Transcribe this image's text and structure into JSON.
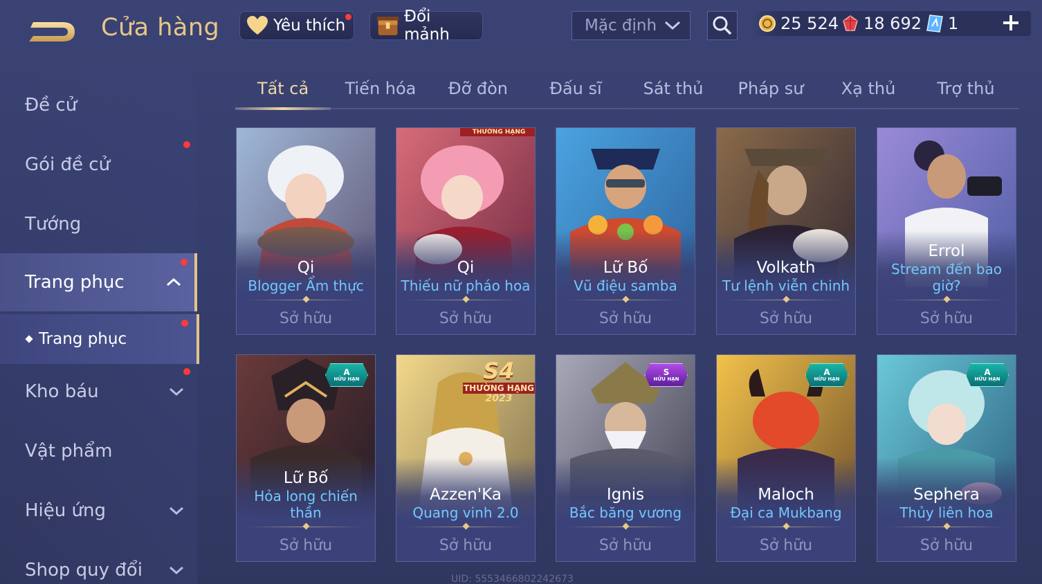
{
  "header": {
    "title": "Cửa hàng",
    "favorite_label": "Yêu thích",
    "fragment_label": "Đổi mảnh",
    "sort": {
      "selected": "Mặc định"
    },
    "currencies": {
      "gold": "25 524",
      "ruby": "18 692",
      "voucher": "1"
    }
  },
  "sidebar": {
    "items": [
      {
        "label": "Đề cử"
      },
      {
        "label": "Gói đề cử"
      },
      {
        "label": "Tướng"
      },
      {
        "label": "Trang phục"
      },
      {
        "label": "Kho báu"
      },
      {
        "label": "Vật phẩm"
      },
      {
        "label": "Hiệu ứng"
      },
      {
        "label": "Shop quy đổi"
      }
    ],
    "sub_item": {
      "label": "Trang phục"
    }
  },
  "tabs": [
    {
      "label": "Tất cả"
    },
    {
      "label": "Tiến hóa"
    },
    {
      "label": "Đỡ đòn"
    },
    {
      "label": "Đấu sĩ"
    },
    {
      "label": "Sát thủ"
    },
    {
      "label": "Pháp sư"
    },
    {
      "label": "Xạ thủ"
    },
    {
      "label": "Trợ thủ"
    }
  ],
  "cards": [
    {
      "hero": "Qi",
      "skin": "Blogger Ẩm thực",
      "status": "Sở hữu"
    },
    {
      "hero": "Qi",
      "skin": "Thiếu nữ pháo hoa",
      "status": "Sở hữu",
      "ribbon": "THƯỜNG HẠNG"
    },
    {
      "hero": "Lữ Bố",
      "skin": "Vũ điệu samba",
      "status": "Sở hữu"
    },
    {
      "hero": "Volkath",
      "skin": "Tư lệnh viễn chinh",
      "status": "Sở hữu"
    },
    {
      "hero": "Errol",
      "skin": "Stream đến bao giờ?",
      "status": "Sở hữu"
    },
    {
      "hero": "Lữ Bố",
      "skin": "Hỏa long chiến thần",
      "status": "Sở hữu",
      "badge": {
        "grade": "A",
        "text": "HỮU HẠN"
      }
    },
    {
      "hero": "Azzen'Ka",
      "skin": "Quang vinh 2.0",
      "status": "Sở hữu",
      "rank": {
        "season": "S4",
        "label": "THƯỜNG HẠNG",
        "year": "2023"
      }
    },
    {
      "hero": "Ignis",
      "skin": "Bắc băng vương",
      "status": "Sở hữu",
      "badge": {
        "grade": "S",
        "text": "HỮU HẠN"
      }
    },
    {
      "hero": "Maloch",
      "skin": "Đại ca Mukbang",
      "status": "Sở hữu",
      "badge": {
        "grade": "A",
        "text": "HỮU HẠN"
      }
    },
    {
      "hero": "Sephera",
      "skin": "Thủy liên hoa",
      "status": "Sở hữu",
      "badge": {
        "grade": "A",
        "text": "HỮU HẠN"
      }
    }
  ],
  "footer": {
    "uid": "UID: 5553466802242673"
  },
  "colors": {
    "accent": "#e7c788",
    "skin_name": "#72c8ff",
    "notification": "#ff3b3b"
  },
  "icons": [
    "back-arrow-icon",
    "heart-icon",
    "chest-icon",
    "chevron-down-icon",
    "search-icon",
    "gold-coin-icon",
    "ruby-icon",
    "voucher-icon",
    "plus-icon",
    "chevron-up-icon"
  ]
}
